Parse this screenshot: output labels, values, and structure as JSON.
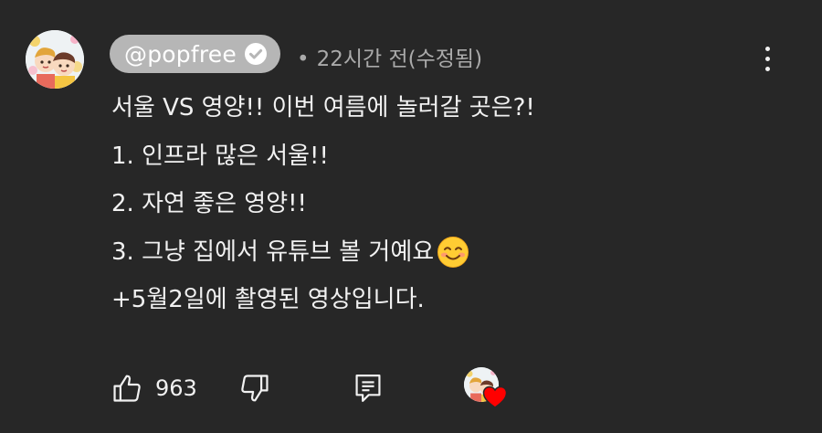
{
  "comment": {
    "author": "@popfree",
    "verified": true,
    "timestamp": "22시간 전(수정됨)",
    "lines": [
      "서울 VS 영양!! 이번 여름에 놀러갈 곳은?!",
      "1. 인프라 많은 서울!!",
      "2. 자연 좋은 영양!!",
      "3. 그냥 집에서 유튜브 볼 거예요",
      "+5월2일에 촬영된 영상입니다."
    ],
    "line_emoji": "smiling-face-with-smiling-eyes"
  },
  "actions": {
    "like_count": "963",
    "like_icon": "thumbs-up-icon",
    "dislike_icon": "thumbs-down-icon",
    "reply_icon": "reply-comment-icon",
    "creator_heart": "creator-heart-icon"
  },
  "colors": {
    "background": "#272727",
    "author_chip": "#b6b6b6",
    "text": "#f1f1f1",
    "meta": "#aaaaaa",
    "heart": "#ff0000"
  }
}
